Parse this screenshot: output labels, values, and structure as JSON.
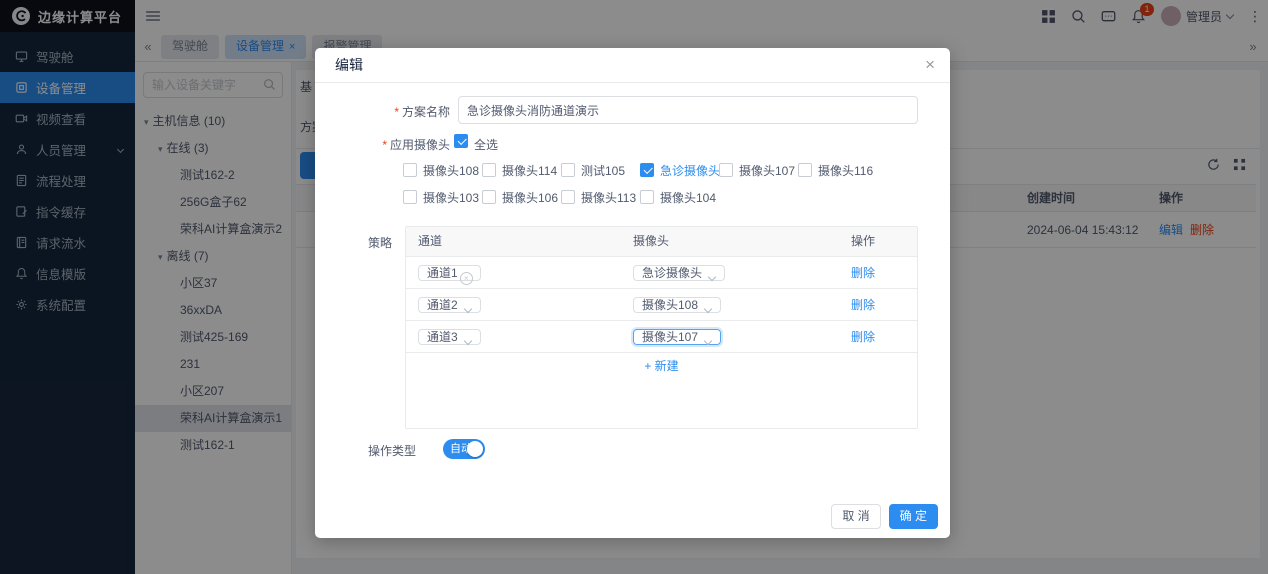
{
  "header": {
    "app_title": "边缘计算平台",
    "user_name": "管理员",
    "notification_count": "1"
  },
  "icons": {
    "collapse": "«",
    "expand": "»",
    "close": "×",
    "more": "⋮",
    "caret": "▾",
    "clear": "×"
  },
  "tabbar": {
    "tabs": [
      {
        "label": "驾驶舱",
        "active": false
      },
      {
        "label": "设备管理",
        "active": true,
        "closable": true
      },
      {
        "label": "报警管理",
        "active": false
      }
    ]
  },
  "sidebar": {
    "items": [
      {
        "label": "驾驶舱"
      },
      {
        "label": "设备管理",
        "active": true
      },
      {
        "label": "视频查看"
      },
      {
        "label": "人员管理",
        "expandable": true
      },
      {
        "label": "流程处理"
      },
      {
        "label": "指令缓存"
      },
      {
        "label": "请求流水"
      },
      {
        "label": "信息模版"
      },
      {
        "label": "系统配置"
      }
    ]
  },
  "tree": {
    "search_placeholder": "输入设备关键字",
    "root_label": "主机信息 (10)",
    "groups": [
      {
        "label": "在线 (3)",
        "items": [
          {
            "label": "测试162-2"
          },
          {
            "label": "256G盒子62"
          },
          {
            "label": "荣科AI计算盒演示2"
          }
        ]
      },
      {
        "label": "离线 (7)",
        "items": [
          {
            "label": "小区37"
          },
          {
            "label": "36xxDA"
          },
          {
            "label": "测试425-169"
          },
          {
            "label": "231"
          },
          {
            "label": "小区207"
          },
          {
            "label": "荣科AI计算盒演示1",
            "selected": true
          },
          {
            "label": "测试162-1"
          }
        ]
      }
    ]
  },
  "background_page": {
    "section_tab_partial": "基",
    "filter_label": "方案名称",
    "table": {
      "col_created": "创建时间",
      "col_actions": "操作",
      "row_created": "2024-06-04 15:43:12",
      "row_edit": "编辑",
      "row_delete": "删除"
    }
  },
  "modal": {
    "title": "编辑",
    "scheme_name": {
      "label": "方案名称",
      "value": "急诊摄像头消防通道演示"
    },
    "apply_cameras": {
      "label": "应用摄像头",
      "select_all_label": "全选",
      "options": [
        {
          "label": "摄像头108",
          "checked": false
        },
        {
          "label": "摄像头114",
          "checked": false
        },
        {
          "label": "测试105",
          "checked": false
        },
        {
          "label": "急诊摄像头",
          "checked": true
        },
        {
          "label": "摄像头107",
          "checked": false
        },
        {
          "label": "摄像头116",
          "checked": false
        },
        {
          "label": "摄像头103",
          "checked": false
        },
        {
          "label": "摄像头106",
          "checked": false
        },
        {
          "label": "摄像头113",
          "checked": false
        },
        {
          "label": "摄像头104",
          "checked": false
        }
      ]
    },
    "strategy": {
      "label": "策略",
      "columns": [
        "通道",
        "摄像头",
        "操作"
      ],
      "rows": [
        {
          "channel": "通道1",
          "camera": "急诊摄像头",
          "action": "删除"
        },
        {
          "channel": "通道2",
          "camera": "摄像头108",
          "action": "删除"
        },
        {
          "channel": "通道3",
          "camera": "摄像头107",
          "action": "删除"
        }
      ],
      "add_label": "+ 新建"
    },
    "operation_type": {
      "label": "操作类型",
      "switch_label": "自动",
      "switch_on": true
    },
    "footer": {
      "cancel_label": "取 消",
      "confirm_label": "确 定"
    }
  },
  "colors": {
    "primary": "#2d8cf0",
    "danger": "#ed4014"
  }
}
